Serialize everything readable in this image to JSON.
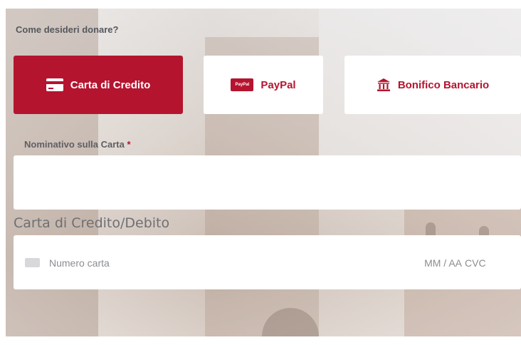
{
  "donation": {
    "question": "Come desideri donare?",
    "methods": [
      {
        "label": "Carta di Credito",
        "icon": "credit-card-icon",
        "selected": true
      },
      {
        "label": "PayPal",
        "icon": "paypal-icon",
        "icon_text": "PayPal",
        "selected": false
      },
      {
        "label": "Bonifico Bancario",
        "icon": "bank-icon",
        "selected": false
      }
    ]
  },
  "cardholder": {
    "label": "Nominativo sulla Carta",
    "required_mark": "*",
    "value": ""
  },
  "card": {
    "section_title": "Carta di Credito/Debito",
    "icon": "card-placeholder-icon",
    "number_placeholder": "Numero carta",
    "expiry_placeholder": "MM / AA",
    "cvc_placeholder": "CVC"
  },
  "colors": {
    "accent": "#b5142f",
    "label_text": "#5f5f63",
    "placeholder_text": "#8a8d92"
  }
}
